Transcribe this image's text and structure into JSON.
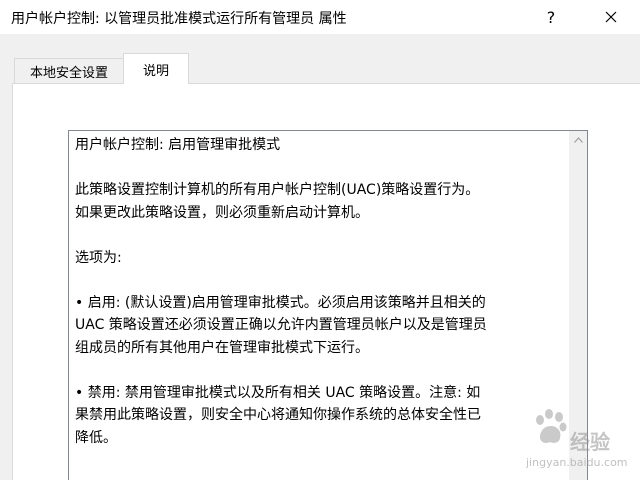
{
  "window": {
    "title": "用户帐户控制: 以管理员批准模式运行所有管理员 属性",
    "help_label": "?",
    "close_icon": "close-icon"
  },
  "tabs": [
    {
      "label": "本地安全设置",
      "active": false
    },
    {
      "label": "说明",
      "active": true
    }
  ],
  "explain": {
    "heading": "用户帐户控制: 启用管理审批模式",
    "para1": [
      "此策略设置控制计算机的所有用户帐户控制(UAC)策略设置行为。",
      "如果更改此策略设置，则必须重新启动计算机。"
    ],
    "options_label": "选项为:",
    "option_enabled": [
      "• 启用: (默认设置)启用管理审批模式。必须启用该策略并且相关的",
      "UAC 策略设置还必须设置正确以允许内置管理员帐户以及是管理员",
      "组成员的所有其他用户在管理审批模式下运行。"
    ],
    "option_disabled": [
      "• 禁用: 禁用管理审批模式以及所有相关 UAC 策略设置。注意: 如",
      "果禁用此策略设置，则安全中心将通知你操作系统的总体安全性已",
      "降低。"
    ]
  },
  "scrollbar": {
    "up_icon": "chevron-up-icon"
  },
  "watermark": {
    "brand": "经验",
    "url": "jingyan.baidu.com"
  },
  "colors": {
    "dialog_bg": "#f0f0f0",
    "panel_bg": "#ffffff",
    "border": "#d9d9d9",
    "textbox_border": "#828790"
  }
}
